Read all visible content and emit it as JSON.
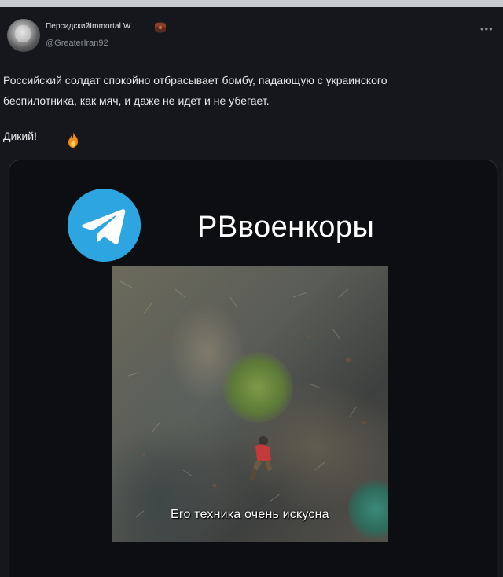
{
  "post": {
    "display_name": "ПерсидскийImmortal W",
    "handle": "@GreaterIran92",
    "more_label": "•••",
    "text_lines": [
      "Российский солдат спокойно отбрасывает бомбу, падающую с украинского",
      "беспилотника, как мяч, и даже не идет и не убегает."
    ],
    "text_line2": "Дикий!"
  },
  "media": {
    "channel_name": "РВвоенкоры",
    "subtitle": "Его техника очень искусна"
  },
  "colors": {
    "background": "#15171c",
    "telegram_blue": "#2ca5e0",
    "text": "#e7e9ea",
    "muted": "#8b8f96"
  },
  "icons": {
    "badge": "flag-badge-icon",
    "emoji": "fire-emoji-icon",
    "logo": "telegram-logo-icon",
    "more": "more-options-icon"
  }
}
